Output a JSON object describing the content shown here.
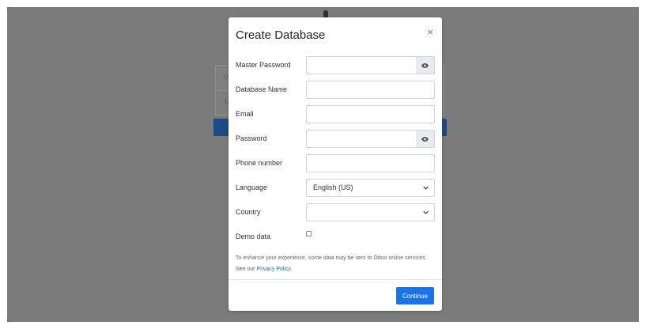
{
  "modal": {
    "title": "Create Database",
    "close_symbol": "×",
    "fields": {
      "master_password": {
        "label": "Master Password",
        "value": ""
      },
      "database_name": {
        "label": "Database Name",
        "value": ""
      },
      "email": {
        "label": "Email",
        "value": ""
      },
      "password": {
        "label": "Password",
        "value": ""
      },
      "phone": {
        "label": "Phone number",
        "value": ""
      },
      "language": {
        "label": "Language",
        "selected": "English (US)"
      },
      "country": {
        "label": "Country",
        "selected": ""
      },
      "demo_data": {
        "label": "Demo data",
        "checked": false
      }
    },
    "notice": {
      "text": "To enhance your experience, some data may be sent to Odoo online services. See our ",
      "link_label": "Privacy Policy",
      "suffix": "."
    },
    "continue_label": "Continue"
  },
  "background": {
    "link_1": "U",
    "link_2": "Te"
  },
  "colors": {
    "backdrop": "#7b7b7b",
    "primary_button": "#1a73e8",
    "link": "#1f6fb5"
  },
  "icons": {
    "eye": "eye-icon",
    "chevron": "chevron-down-icon",
    "close": "close-icon"
  }
}
